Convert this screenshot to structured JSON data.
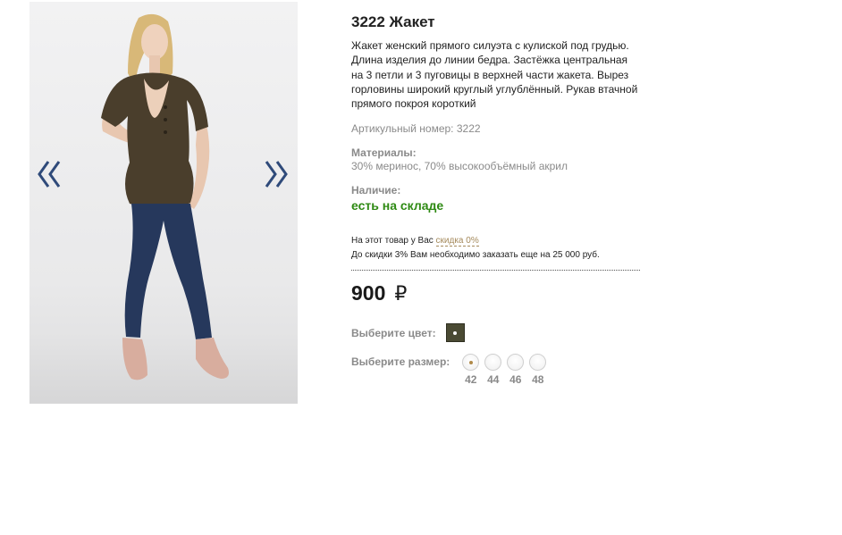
{
  "product": {
    "title": "3222 Жакет",
    "description": "Жакет женский прямого силуэта с кулиской под грудью. Длина изделия до линии бедра. Застёжка центральная на 3 петли и 3 пуговицы в верхней части жакета. Вырез горловины широкий круглый углублённый. Рукав втачной прямого покроя короткий",
    "sku_text": "Артикульный номер: 3222",
    "materials_label": "Материалы:",
    "materials_value": "30% меринос, 70% высокообъёмный акрил",
    "availability_label": "Наличие:",
    "availability_value": "есть на складе",
    "price_value": "900",
    "price_currency": "₽"
  },
  "discount": {
    "line1_prefix": "На этот товар у Вас ",
    "line1_link": "скидка 0%",
    "line2": "До скидки 3% Вам необходимо заказать еще на 25 000 руб."
  },
  "options": {
    "color_label": "Выберите цвет:",
    "size_label": "Выберите размер:",
    "sizes": [
      {
        "label": "42",
        "selected": true
      },
      {
        "label": "44",
        "selected": false
      },
      {
        "label": "46",
        "selected": false
      },
      {
        "label": "48",
        "selected": false
      }
    ]
  },
  "colors": {
    "swatch": "#4a4a33",
    "available": "#2e8a13",
    "discount_link": "#a58a5c",
    "arrow": "#2f4a7a"
  },
  "icons": {
    "prev": "double-chevron-left-icon",
    "next": "double-chevron-right-icon"
  }
}
